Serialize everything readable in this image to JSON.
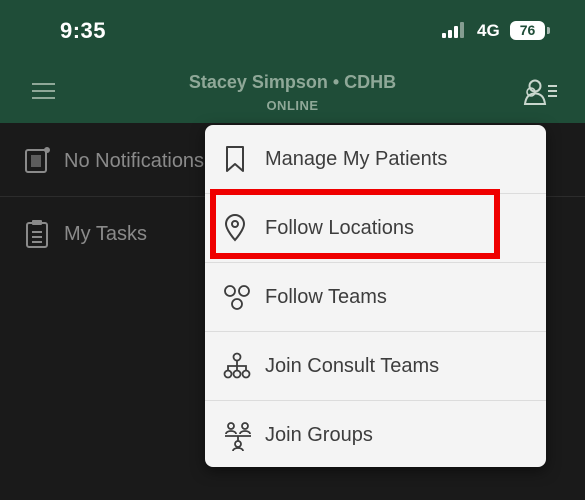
{
  "status_bar": {
    "time": "9:35",
    "network": "4G",
    "battery": "76",
    "icons": [
      "signal-icon",
      "battery-icon"
    ]
  },
  "header": {
    "title": "Stacey Simpson • CDHB",
    "subtitle": "ONLINE",
    "background": "#1f4d38",
    "icons": [
      "hamburger-menu-icon",
      "user-list-icon"
    ]
  },
  "list": {
    "notifications_label": "No Notifications",
    "tasks_label": "My Tasks"
  },
  "dropdown": {
    "items": [
      {
        "label": "Manage My Patients",
        "icon": "bookmark-icon"
      },
      {
        "label": "Follow Locations",
        "icon": "location-pin-icon",
        "highlighted": true
      },
      {
        "label": "Follow Teams",
        "icon": "teams-circles-icon"
      },
      {
        "label": "Join Consult Teams",
        "icon": "hierarchy-icon"
      },
      {
        "label": "Join Groups",
        "icon": "groups-icon"
      }
    ],
    "highlight_color": "#ef0000"
  }
}
